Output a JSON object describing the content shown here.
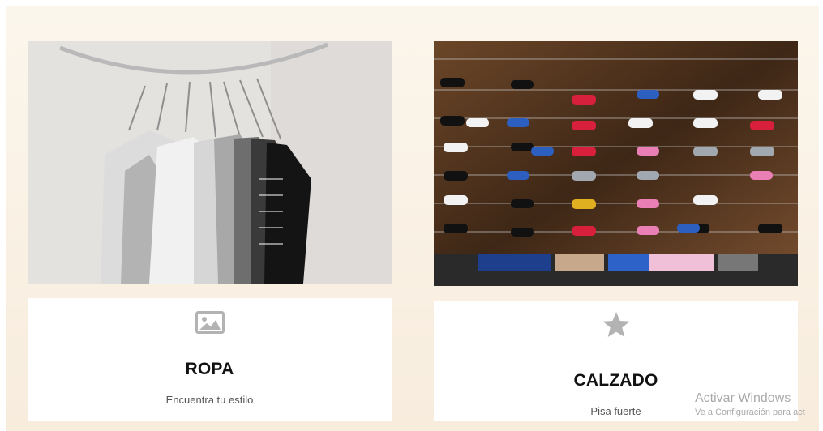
{
  "cards": [
    {
      "title": "ROPA",
      "subtitle": "Encuentra tu estilo",
      "icon": "image-icon",
      "image": "clothes-on-hangers"
    },
    {
      "title": "CALZADO",
      "subtitle": "Pisa fuerte",
      "icon": "star-icon",
      "image": "shoe-wall-display"
    }
  ],
  "watermark": {
    "title": "Activar Windows",
    "subtitle": "Ve a Configuración para act"
  },
  "colors": {
    "background": "#fbf6ec",
    "card": "#ffffff",
    "icon": "#b3b3b3",
    "title": "#111111"
  }
}
